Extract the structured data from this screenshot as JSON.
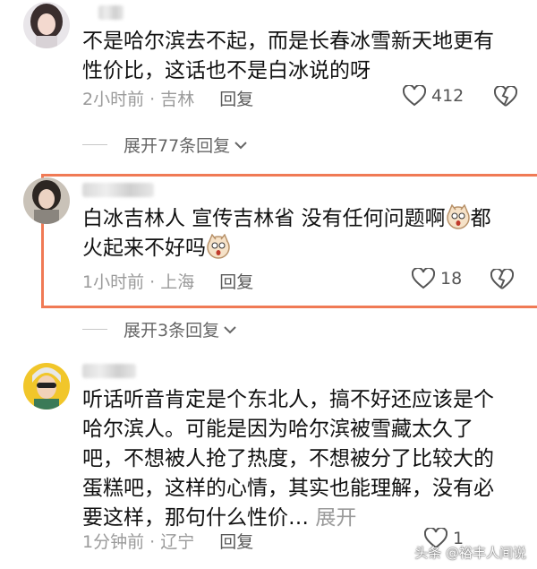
{
  "comments": [
    {
      "text": "不是哈尔滨去不起，而是长春冰雪新天地更有性价比，这话也不是白冰说的呀",
      "time": "2小时前",
      "location": "吉林",
      "reply_label": "回复",
      "likes": "412",
      "expand": "展开77条回复"
    },
    {
      "text_part1": "白冰吉林人 宣传吉林省 没有任何问题啊",
      "text_part2": "都火起来不好吗",
      "time": "1小时前",
      "location": "上海",
      "reply_label": "回复",
      "likes": "18",
      "expand": "展开3条回复"
    },
    {
      "text": "听话听音肯定是个东北人，搞不好还应该是个哈尔滨人。可能是因为哈尔滨被雪藏太久了吧，不想被人抢了热度，不想被分了比较大的蛋糕吧，这样的心情，其实也能理解，没有必要这样，那句什么性价…",
      "more": "展开",
      "time": "1分钟前",
      "location": "辽宁",
      "reply_label": "回复",
      "likes": "1"
    }
  ],
  "meta_separator": "·",
  "watermark": "头条 @裕丰人间说",
  "colors": {
    "highlight": "#f07a55",
    "text": "#111111",
    "meta": "#9a9a9a"
  }
}
